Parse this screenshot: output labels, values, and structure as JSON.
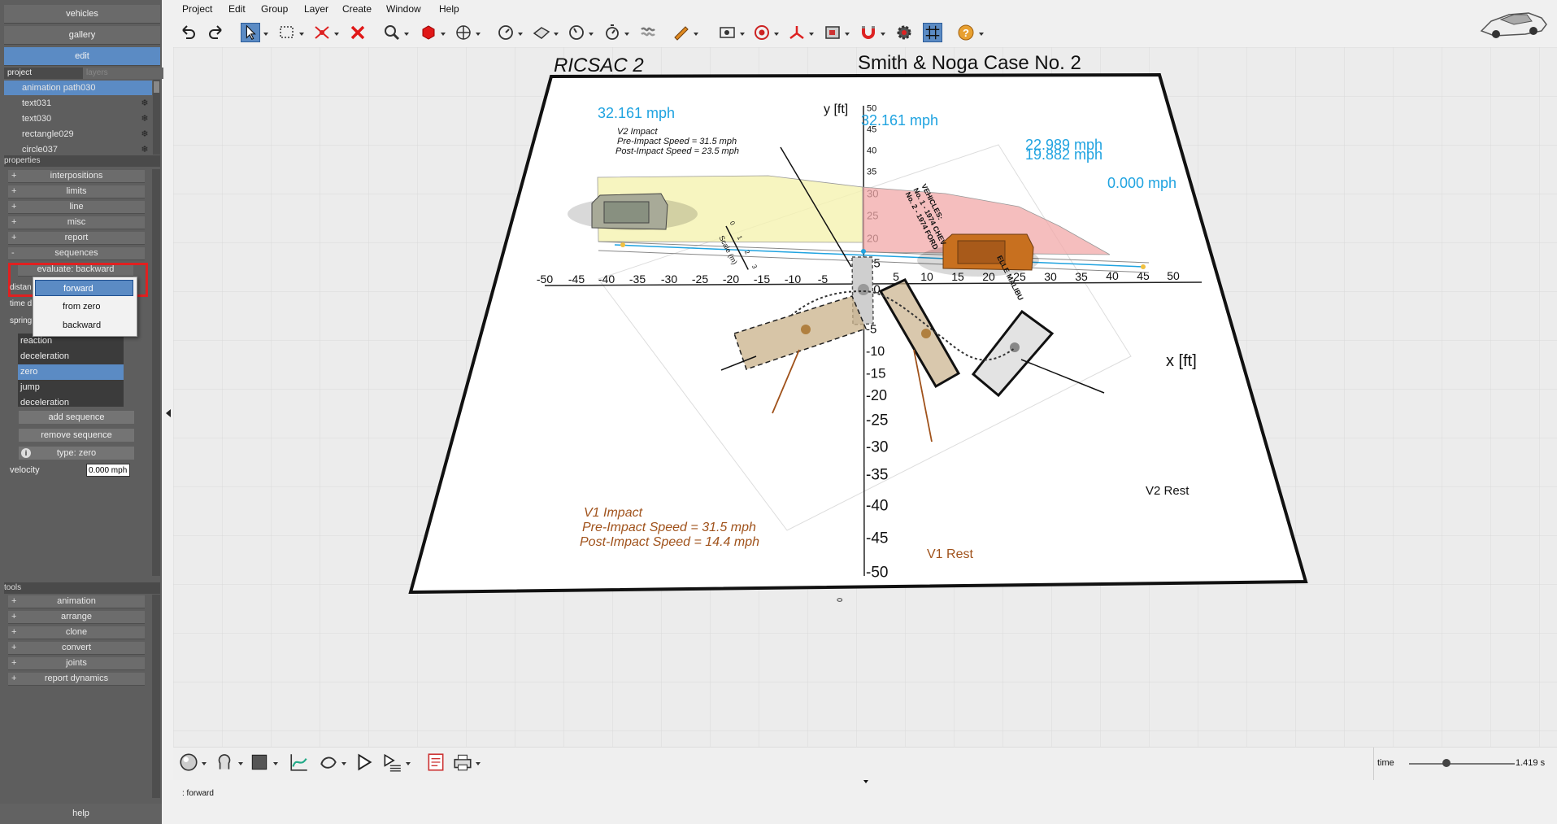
{
  "left_panel": {
    "top_buttons": [
      "vehicles",
      "gallery",
      "edit"
    ],
    "tabs": {
      "project": "project",
      "layers": "layers"
    },
    "project_items": [
      {
        "label": "animation path030",
        "selected": true
      },
      {
        "label": "text031"
      },
      {
        "label": "text030"
      },
      {
        "label": "rectangle029"
      },
      {
        "label": "circle037"
      }
    ],
    "properties_header": "properties",
    "properties": [
      {
        "sign": "+",
        "label": "interpositions"
      },
      {
        "sign": "+",
        "label": "limits"
      },
      {
        "sign": "+",
        "label": "line"
      },
      {
        "sign": "+",
        "label": "misc"
      },
      {
        "sign": "+",
        "label": "report"
      },
      {
        "sign": "-",
        "label": "sequences"
      }
    ],
    "evaluate_label": "evaluate: backward",
    "partial_labels": [
      "distan",
      "time d",
      "spring"
    ],
    "dropdown_options": [
      {
        "label": "forward",
        "selected": true
      },
      {
        "label": "from zero"
      },
      {
        "label": "backward"
      }
    ],
    "sequence_list": [
      {
        "label": "reaction"
      },
      {
        "label": "deceleration"
      },
      {
        "label": "zero",
        "selected": true
      },
      {
        "label": "jump"
      },
      {
        "label": "deceleration"
      }
    ],
    "add_sequence": "add sequence",
    "remove_sequence": "remove sequence",
    "type_label": "type: zero",
    "velocity_label": "velocity",
    "velocity_value": "0.000 mph",
    "tools_header": "tools",
    "tools": [
      {
        "sign": "+",
        "label": "animation"
      },
      {
        "sign": "+",
        "label": "arrange"
      },
      {
        "sign": "+",
        "label": "clone"
      },
      {
        "sign": "+",
        "label": "convert"
      },
      {
        "sign": "+",
        "label": "joints"
      },
      {
        "sign": "+",
        "label": "report dynamics"
      }
    ],
    "help": "help"
  },
  "menu": [
    "Project",
    "Edit",
    "Group",
    "Layer",
    "Create",
    "Window",
    "Help"
  ],
  "toolbar_icons": [
    "undo-icon",
    "redo-icon",
    "select-icon",
    "rectangle-select-icon",
    "delete-vertex-icon",
    "delete-icon",
    "zoom-icon",
    "cube-icon",
    "pan-icon",
    "gauge-icon",
    "surface-icon",
    "measure-icon",
    "stopwatch-icon",
    "spring-icon",
    "pencil-icon",
    "camera-icon",
    "target-icon",
    "axes-icon",
    "image-icon",
    "magnet-icon",
    "settings-icon",
    "grid-icon",
    "help-icon"
  ],
  "scene": {
    "title_left": "RICSAC 2",
    "title_right": "Smith & Noga Case No. 2",
    "y_axis_label": "y [ft]",
    "x_axis_label": "x [ft]",
    "x_ticks": [
      "-50",
      "-45",
      "-40",
      "-35",
      "-30",
      "-25",
      "-20",
      "-15",
      "-10",
      "-5",
      "5",
      "10",
      "15",
      "20",
      "25",
      "30",
      "35",
      "40",
      "45",
      "50"
    ],
    "y_ticks_pos": [
      "50",
      "45",
      "40",
      "35",
      "30",
      "25",
      "20",
      "15",
      "10",
      "5"
    ],
    "y_ticks_neg": [
      "-5",
      "-10",
      "-15",
      "-20",
      "-25",
      "-30",
      "-35",
      "-40",
      "-45",
      "-50"
    ],
    "speed_labels": [
      "32.161 mph",
      "32.161 mph",
      "22.989 mph",
      "19.882 mph",
      "0.000 mph"
    ],
    "v2_impact": [
      "V2 Impact",
      "Pre-Impact Speed = 31.5 mph",
      "Post-Impact Speed = 23.5 mph"
    ],
    "v1_impact": [
      "V1 Impact",
      "Pre-Impact Speed = 31.5 mph",
      "Post-Impact Speed = 14.4 mph"
    ],
    "v1_rest": "V1 Rest",
    "v2_rest": "V2 Rest",
    "vehicles_note": [
      "VEHICLES:",
      "No. 1 - 1974 CHEV",
      "No. 2 - 1974 FORD"
    ],
    "malibu": "ELLE MALIBU",
    "scale_label": "Scale (m)",
    "scale_ticks": [
      "0",
      "1",
      "2",
      "3"
    ],
    "zero": "0"
  },
  "bottom": {
    "icons": [
      "sphere-icon",
      "head-icon",
      "material-icon",
      "curve-tool-icon",
      "path-tool-icon",
      "play-icon",
      "sequence-icon",
      "report-icon",
      "print-icon"
    ],
    "time_label": "time",
    "time_value": "1.419 s",
    "time_fraction": 0.35
  },
  "status_text": ": forward",
  "colors": {
    "accent": "#5b8bc4",
    "speed": "#1fa3e0",
    "v1": "#a0521b",
    "highlight": "#e02020"
  }
}
